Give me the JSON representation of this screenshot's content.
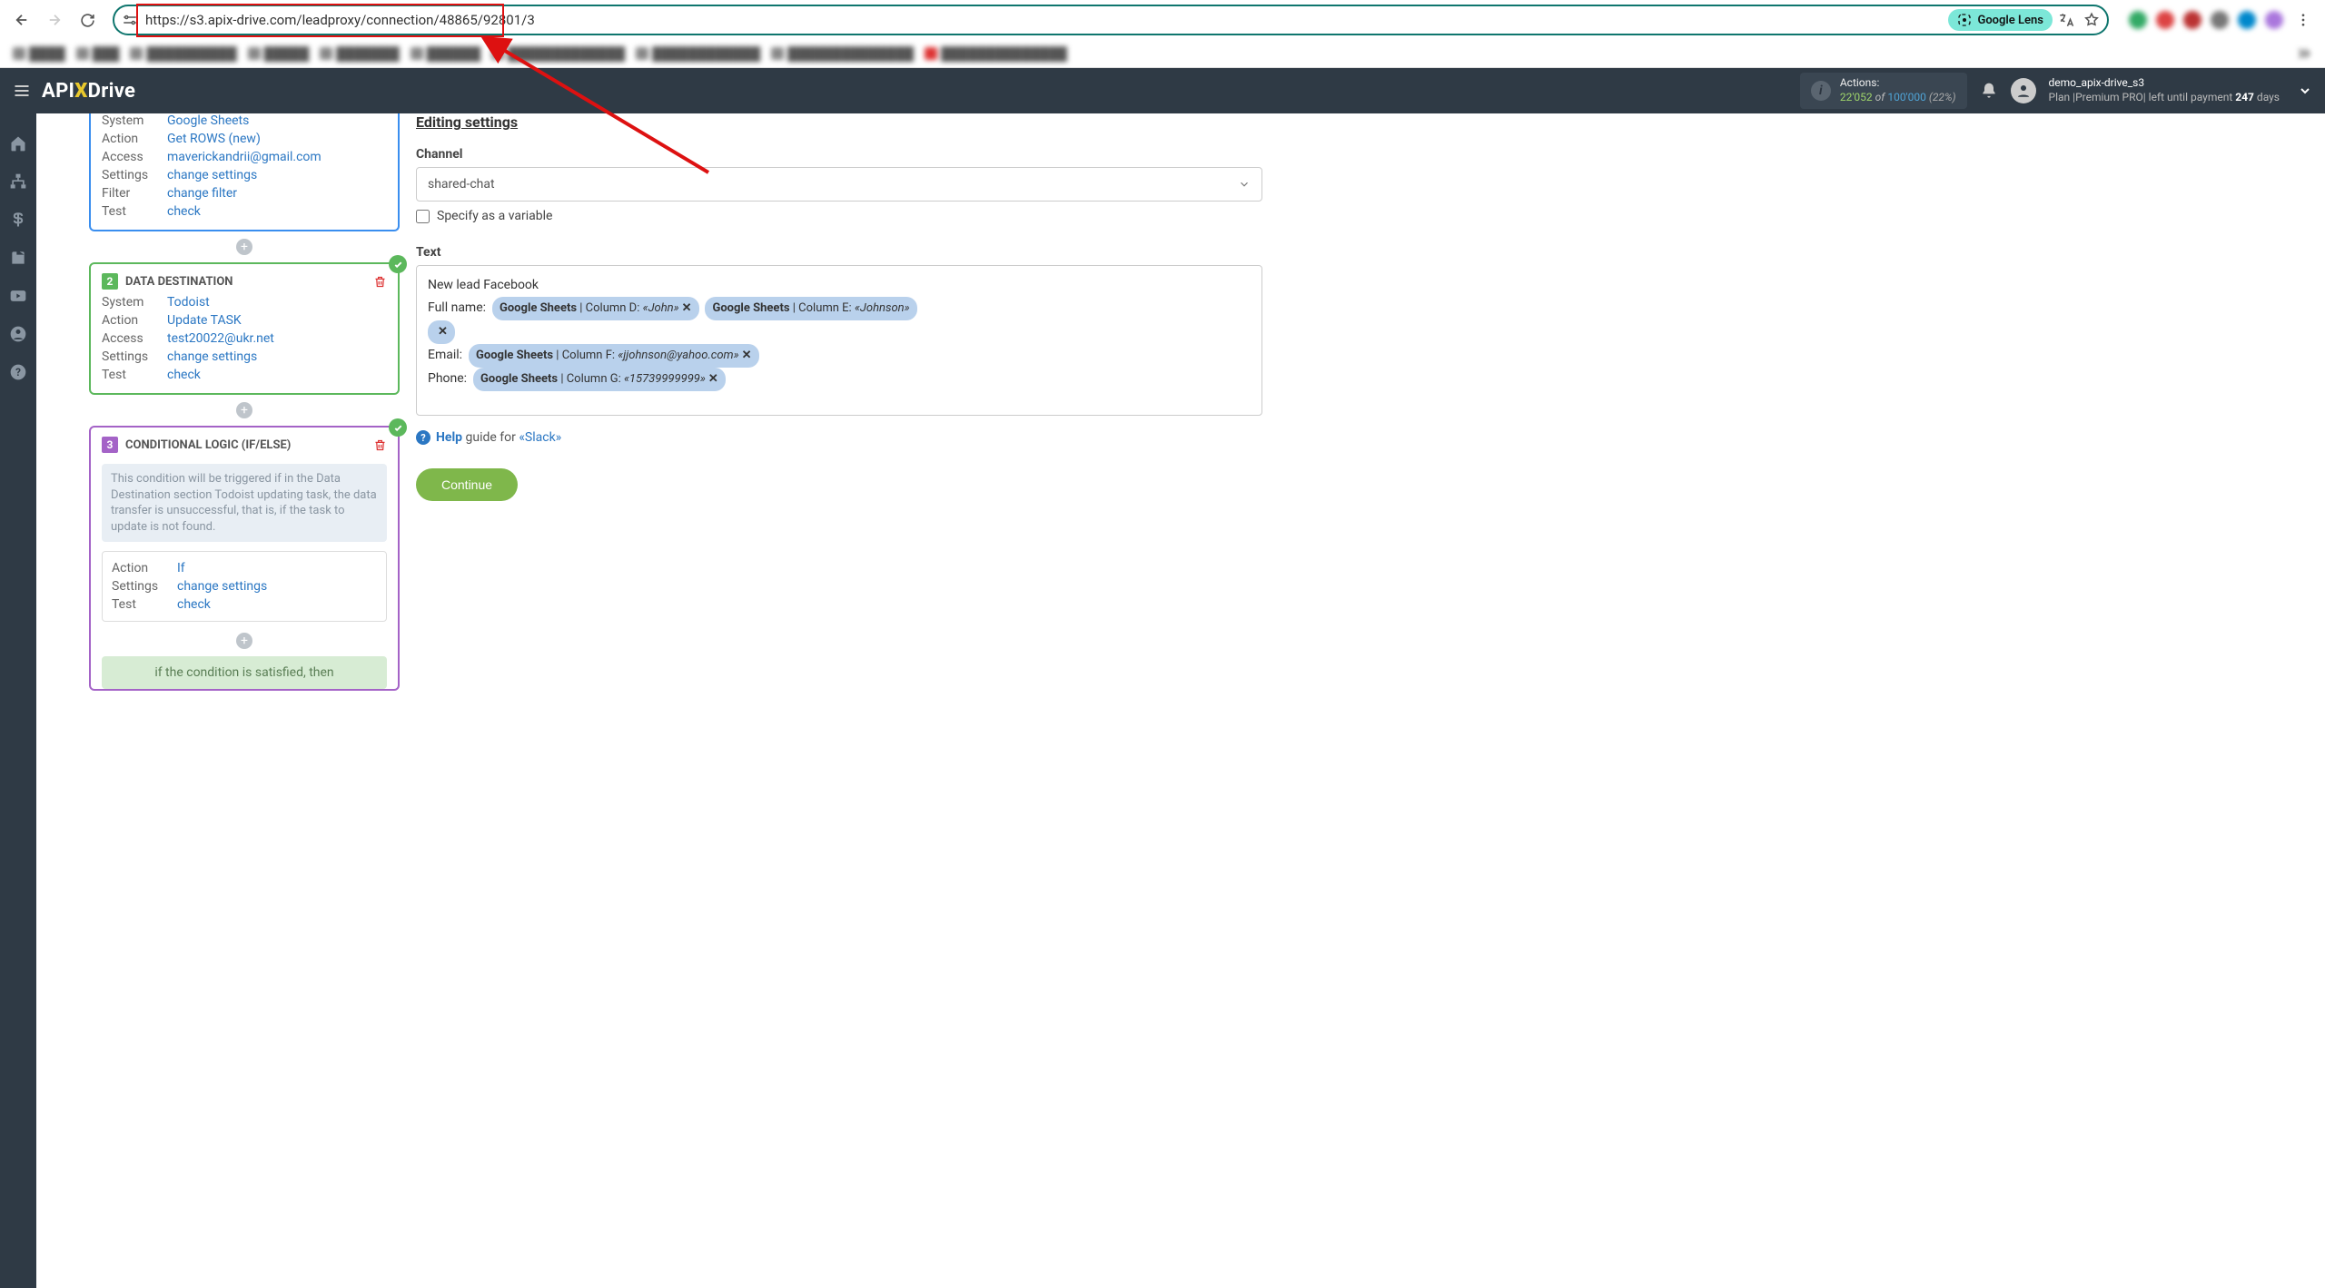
{
  "browser": {
    "url": "https://s3.apix-drive.com/leadproxy/connection/48865/92801/3",
    "lens_label": "Google Lens"
  },
  "bookmarks_blur": [
    "",
    "",
    "",
    "",
    "",
    "",
    "",
    "",
    "",
    ""
  ],
  "header": {
    "actions_label": "Actions:",
    "actions_used": "22'052",
    "actions_of": "of",
    "actions_total": "100'000",
    "actions_pct": "(22%)",
    "username": "demo_apix-drive_s3",
    "plan_prefix": "Plan |Premium PRO| left until payment",
    "plan_days_num": "247",
    "plan_days_word": "days"
  },
  "sidebar": {
    "source_rows": [
      {
        "key": "System",
        "val": "Google Sheets"
      },
      {
        "key": "Action",
        "val": "Get ROWS (new)"
      },
      {
        "key": "Access",
        "val": "maverickandrii@gmail.com"
      },
      {
        "key": "Settings",
        "val": "change settings"
      },
      {
        "key": "Filter",
        "val": "change filter"
      },
      {
        "key": "Test",
        "val": "check"
      }
    ],
    "dest_num": "2",
    "dest_title": "DATA DESTINATION",
    "dest_rows": [
      {
        "key": "System",
        "val": "Todoist"
      },
      {
        "key": "Action",
        "val": "Update TASK"
      },
      {
        "key": "Access",
        "val": "test20022@ukr.net"
      },
      {
        "key": "Settings",
        "val": "change settings"
      },
      {
        "key": "Test",
        "val": "check"
      }
    ],
    "cond_num": "3",
    "cond_title": "CONDITIONAL LOGIC (IF/ELSE)",
    "cond_note": "This condition will be triggered if in the Data Destination section Todoist updating task, the data transfer is unsuccessful, that is, if the task to update is not found.",
    "cond_rows": [
      {
        "key": "Action",
        "val": "If"
      },
      {
        "key": "Settings",
        "val": "change settings"
      },
      {
        "key": "Test",
        "val": "check"
      }
    ],
    "cond_then": "if the condition is satisfied, then"
  },
  "main": {
    "editing_title": "Editing settings",
    "channel_label": "Channel",
    "channel_value": "shared-chat",
    "specify_var": "Specify as a variable",
    "text_label": "Text",
    "text_line1": "New lead Facebook",
    "fullname_label": "Full name:",
    "email_label": "Email:",
    "phone_label": "Phone:",
    "token_fullname1": {
      "gs": "Google Sheets",
      "col": " | Column D: ",
      "val": "«John»"
    },
    "token_fullname2": {
      "gs": "Google Sheets",
      "col": " | Column E: ",
      "val": "«Johnson»"
    },
    "token_email": {
      "gs": "Google Sheets",
      "col": " | Column F: ",
      "val": "«jjohnson@yahoo.com»"
    },
    "token_phone": {
      "gs": "Google Sheets",
      "col": " | Column G: ",
      "val": "«15739999999»"
    },
    "help_bold": "Help",
    "help_rest": " guide for ",
    "help_slack": "«Slack»",
    "continue": "Continue"
  }
}
